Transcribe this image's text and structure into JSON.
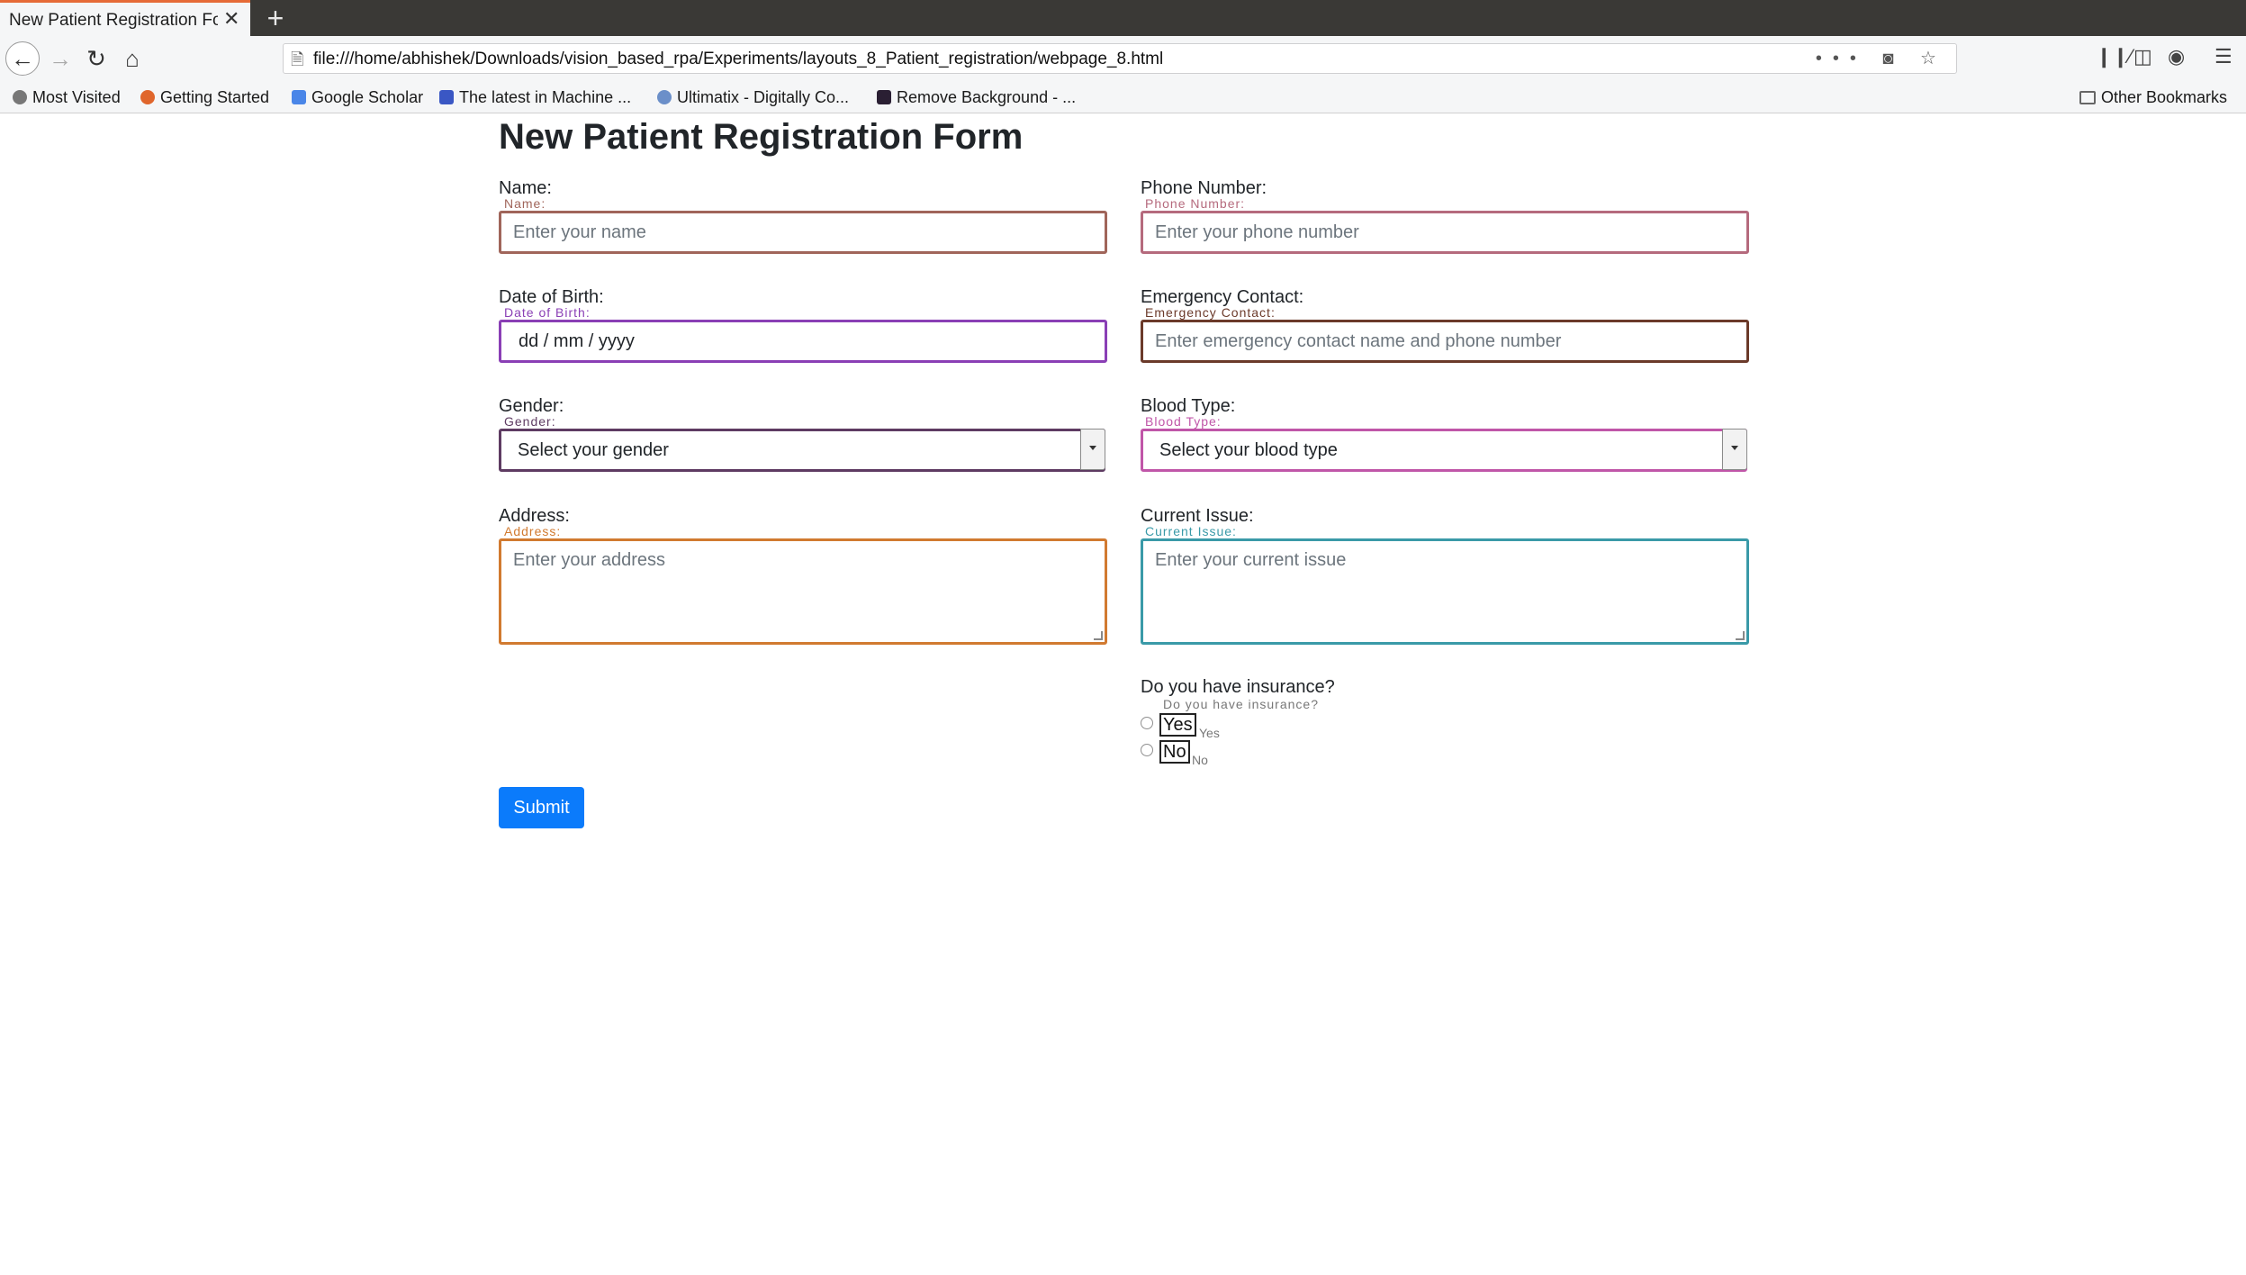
{
  "browser": {
    "tab_title": "New Patient Registration Fo",
    "tab_close": "✕",
    "new_tab": "+",
    "url": "file:///home/abhishek/Downloads/vision_based_rpa/Experiments/layouts_8_Patient_registration/webpage_8.html",
    "url_actions": "••• ◙ ☆",
    "bookmarks": [
      {
        "label": "Most Visited",
        "icon": "gear-icon",
        "color": "#555555"
      },
      {
        "label": "Getting Started",
        "icon": "firefox-icon",
        "color": "#e0662c"
      },
      {
        "label": "Google Scholar",
        "icon": "scholar-icon",
        "color": "#4a86e8"
      },
      {
        "label": "The latest in Machine ...",
        "icon": "bookmark-icon",
        "color": "#3a57c4"
      },
      {
        "label": "Ultimatix - Digitally Co...",
        "icon": "people-icon",
        "color": "#6b8fc9"
      },
      {
        "label": "Remove Background - ...",
        "icon": "image-icon",
        "color": "#2a1f33"
      }
    ],
    "other_bookmarks": "Other Bookmarks"
  },
  "form": {
    "title": "New Patient Registration Form",
    "name": {
      "label": "Name:",
      "tiny": "Name:",
      "placeholder": "Enter your name",
      "color": "#a0655a"
    },
    "phone": {
      "label": "Phone Number:",
      "tiny": "Phone Number:",
      "placeholder": "Enter your phone number",
      "color": "#b56a7d"
    },
    "dob": {
      "label": "Date of Birth:",
      "tiny": "Date of Birth:",
      "value": "dd / mm / yyyy",
      "color": "#8a3fb5"
    },
    "emergency": {
      "label": "Emergency Contact:",
      "tiny": "Emergency Contact:",
      "placeholder": "Enter emergency contact name and phone number",
      "color": "#6b3a2a"
    },
    "gender": {
      "label": "Gender:",
      "tiny": "Gender:",
      "selected": "Select your gender",
      "color": "#5e3b62"
    },
    "blood": {
      "label": "Blood Type:",
      "tiny": "Blood Type:",
      "selected": "Select your blood type",
      "color": "#c056a8"
    },
    "address": {
      "label": "Address:",
      "tiny": "Address:",
      "placeholder": "Enter your address",
      "color": "#d17a30"
    },
    "issue": {
      "label": "Current Issue:",
      "tiny": "Current Issue:",
      "placeholder": "Enter your current issue",
      "color": "#3a9aa8"
    },
    "insurance": {
      "label": "Do you have insurance?",
      "tiny": "Do you have insurance?",
      "yes": "Yes",
      "yes_tiny": "Yes",
      "no": "No",
      "no_tiny": "No"
    },
    "submit": "Submit"
  }
}
